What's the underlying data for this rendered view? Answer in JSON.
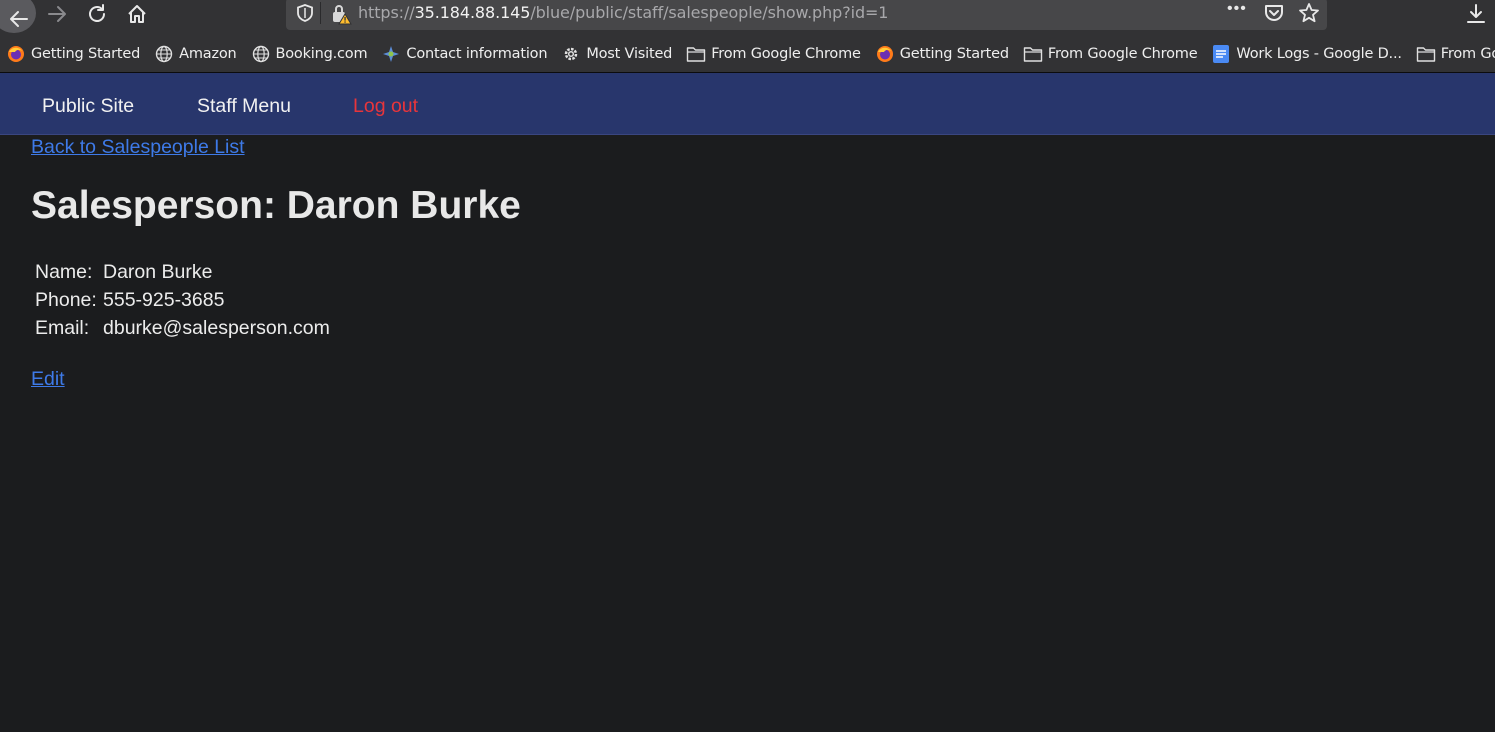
{
  "browser": {
    "url_scheme": "https://",
    "url_host": "35.184.88.145",
    "url_path": "/blue/public/staff/salespeople/show.php?id=1",
    "url_menu": "•••"
  },
  "bookmarks": [
    {
      "label": "Getting Started",
      "icon": "firefox-icon"
    },
    {
      "label": "Amazon",
      "icon": "globe-icon"
    },
    {
      "label": "Booking.com",
      "icon": "globe-icon"
    },
    {
      "label": "Contact information",
      "icon": "puzzle-icon"
    },
    {
      "label": "Most Visited",
      "icon": "gear-icon"
    },
    {
      "label": "From Google Chrome",
      "icon": "folder-icon"
    },
    {
      "label": "Getting Started",
      "icon": "firefox-icon"
    },
    {
      "label": "From Google Chrome",
      "icon": "folder-icon"
    },
    {
      "label": "Work Logs - Google D...",
      "icon": "docs-icon"
    },
    {
      "label": "From Google C",
      "icon": "folder-icon"
    }
  ],
  "nav": {
    "public_site": "Public Site",
    "staff_menu": "Staff Menu",
    "logout": "Log out"
  },
  "content": {
    "back_link": "Back to Salespeople List",
    "title": "Salesperson: Daron Burke",
    "details": [
      {
        "label": "Name:",
        "value": "Daron Burke"
      },
      {
        "label": "Phone:",
        "value": "555-925-3685"
      },
      {
        "label": "Email:",
        "value": "dburke@salesperson.com"
      }
    ],
    "edit_link": "Edit"
  },
  "colors": {
    "page_bg": "#1b1c1e",
    "nav_bg": "#28366c",
    "link": "#3e7ae8",
    "logout": "#e8353b"
  }
}
